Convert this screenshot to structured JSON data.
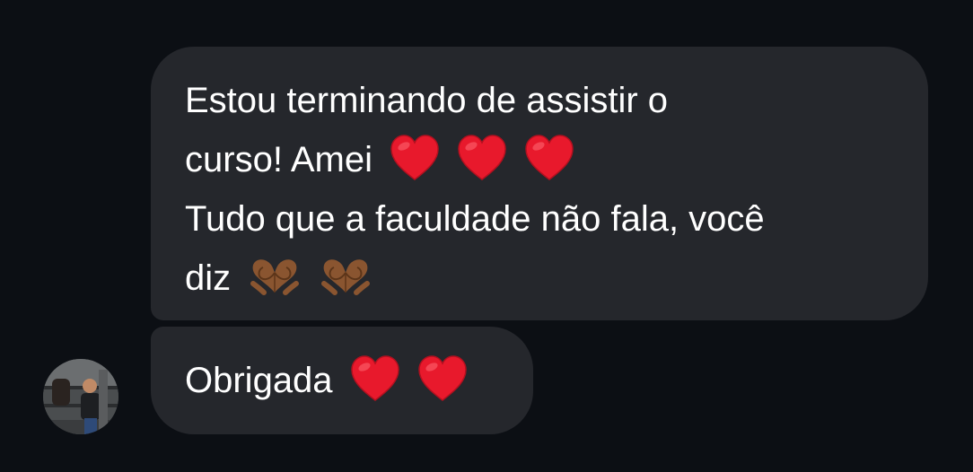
{
  "messages": [
    {
      "lines": [
        "Estou terminando de assistir o",
        "curso! Amei",
        "Tudo que a faculdade não fala, você",
        "diz"
      ],
      "emojis": {
        "line2": [
          "red-heart",
          "red-heart",
          "red-heart"
        ],
        "line4": [
          "heart-hands-medium-dark",
          "heart-hands-medium-dark"
        ]
      }
    },
    {
      "lines": [
        "Obrigada"
      ],
      "emojis": {
        "line1": [
          "red-heart",
          "red-heart"
        ]
      }
    }
  ],
  "colors": {
    "background": "#0c0f14",
    "bubble": "#25272c",
    "text": "#ffffff",
    "heart": "#e8192c",
    "hands": "#8a5530"
  }
}
